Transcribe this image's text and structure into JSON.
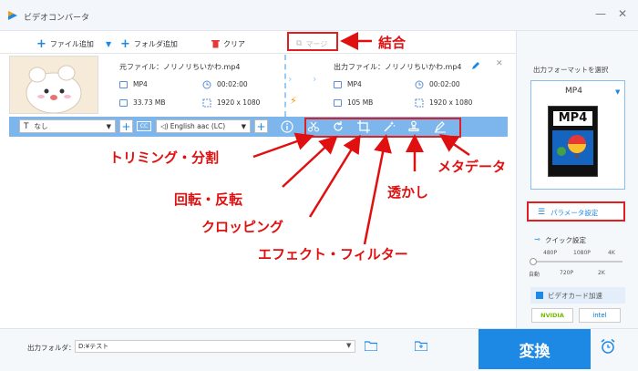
{
  "window": {
    "title": "ビデオコンバータ",
    "min": "—",
    "close": "✕"
  },
  "toolbar": {
    "add_file": "ファイル追加",
    "add_folder": "フォルダ追加",
    "clear": "クリア",
    "merge": "マージ"
  },
  "source": {
    "label": "元ファイル：",
    "filename": "ノリノリちいかわ.mp4",
    "format": "MP4",
    "duration": "00:02:00",
    "size": "33.73 MB",
    "resolution": "1920 x 1080"
  },
  "output": {
    "label": "出力ファイル：",
    "filename": "ノリノリちいかわ.mp4",
    "format": "MP4",
    "duration": "00:02:00",
    "size": "105 MB",
    "resolution": "1920 x 1080"
  },
  "subbar": {
    "subtitle": "なし",
    "audio": "English aac (LC)",
    "cc": "CC"
  },
  "annotations": {
    "merge": "結合",
    "trim": "トリミング・分割",
    "rotate": "回転・反転",
    "crop": "クロッピング",
    "effect": "エフェクト・フィルター",
    "watermark": "透かし",
    "metadata": "メタデータ"
  },
  "right_panel": {
    "select_format": "出力フォーマットを選択",
    "format": "MP4",
    "format_badge": "MP4",
    "param_settings": "パラメータ設定",
    "quick_settings": "クイック設定",
    "ticks_top": [
      "480P",
      "1080P",
      "4K"
    ],
    "ticks_bottom": [
      "自動",
      "720P",
      "2K"
    ],
    "gpu_accel": "ビデオカード加速",
    "nvidia": "NVIDIA",
    "intel": "intel"
  },
  "bottom": {
    "output_folder_label": "出力フォルダ：",
    "output_folder_value": "D:¥テスト",
    "convert": "変換"
  },
  "colors": {
    "accent": "#1e88e5",
    "annotation_red": "#e01010",
    "subbar": "#7cb6ec"
  }
}
